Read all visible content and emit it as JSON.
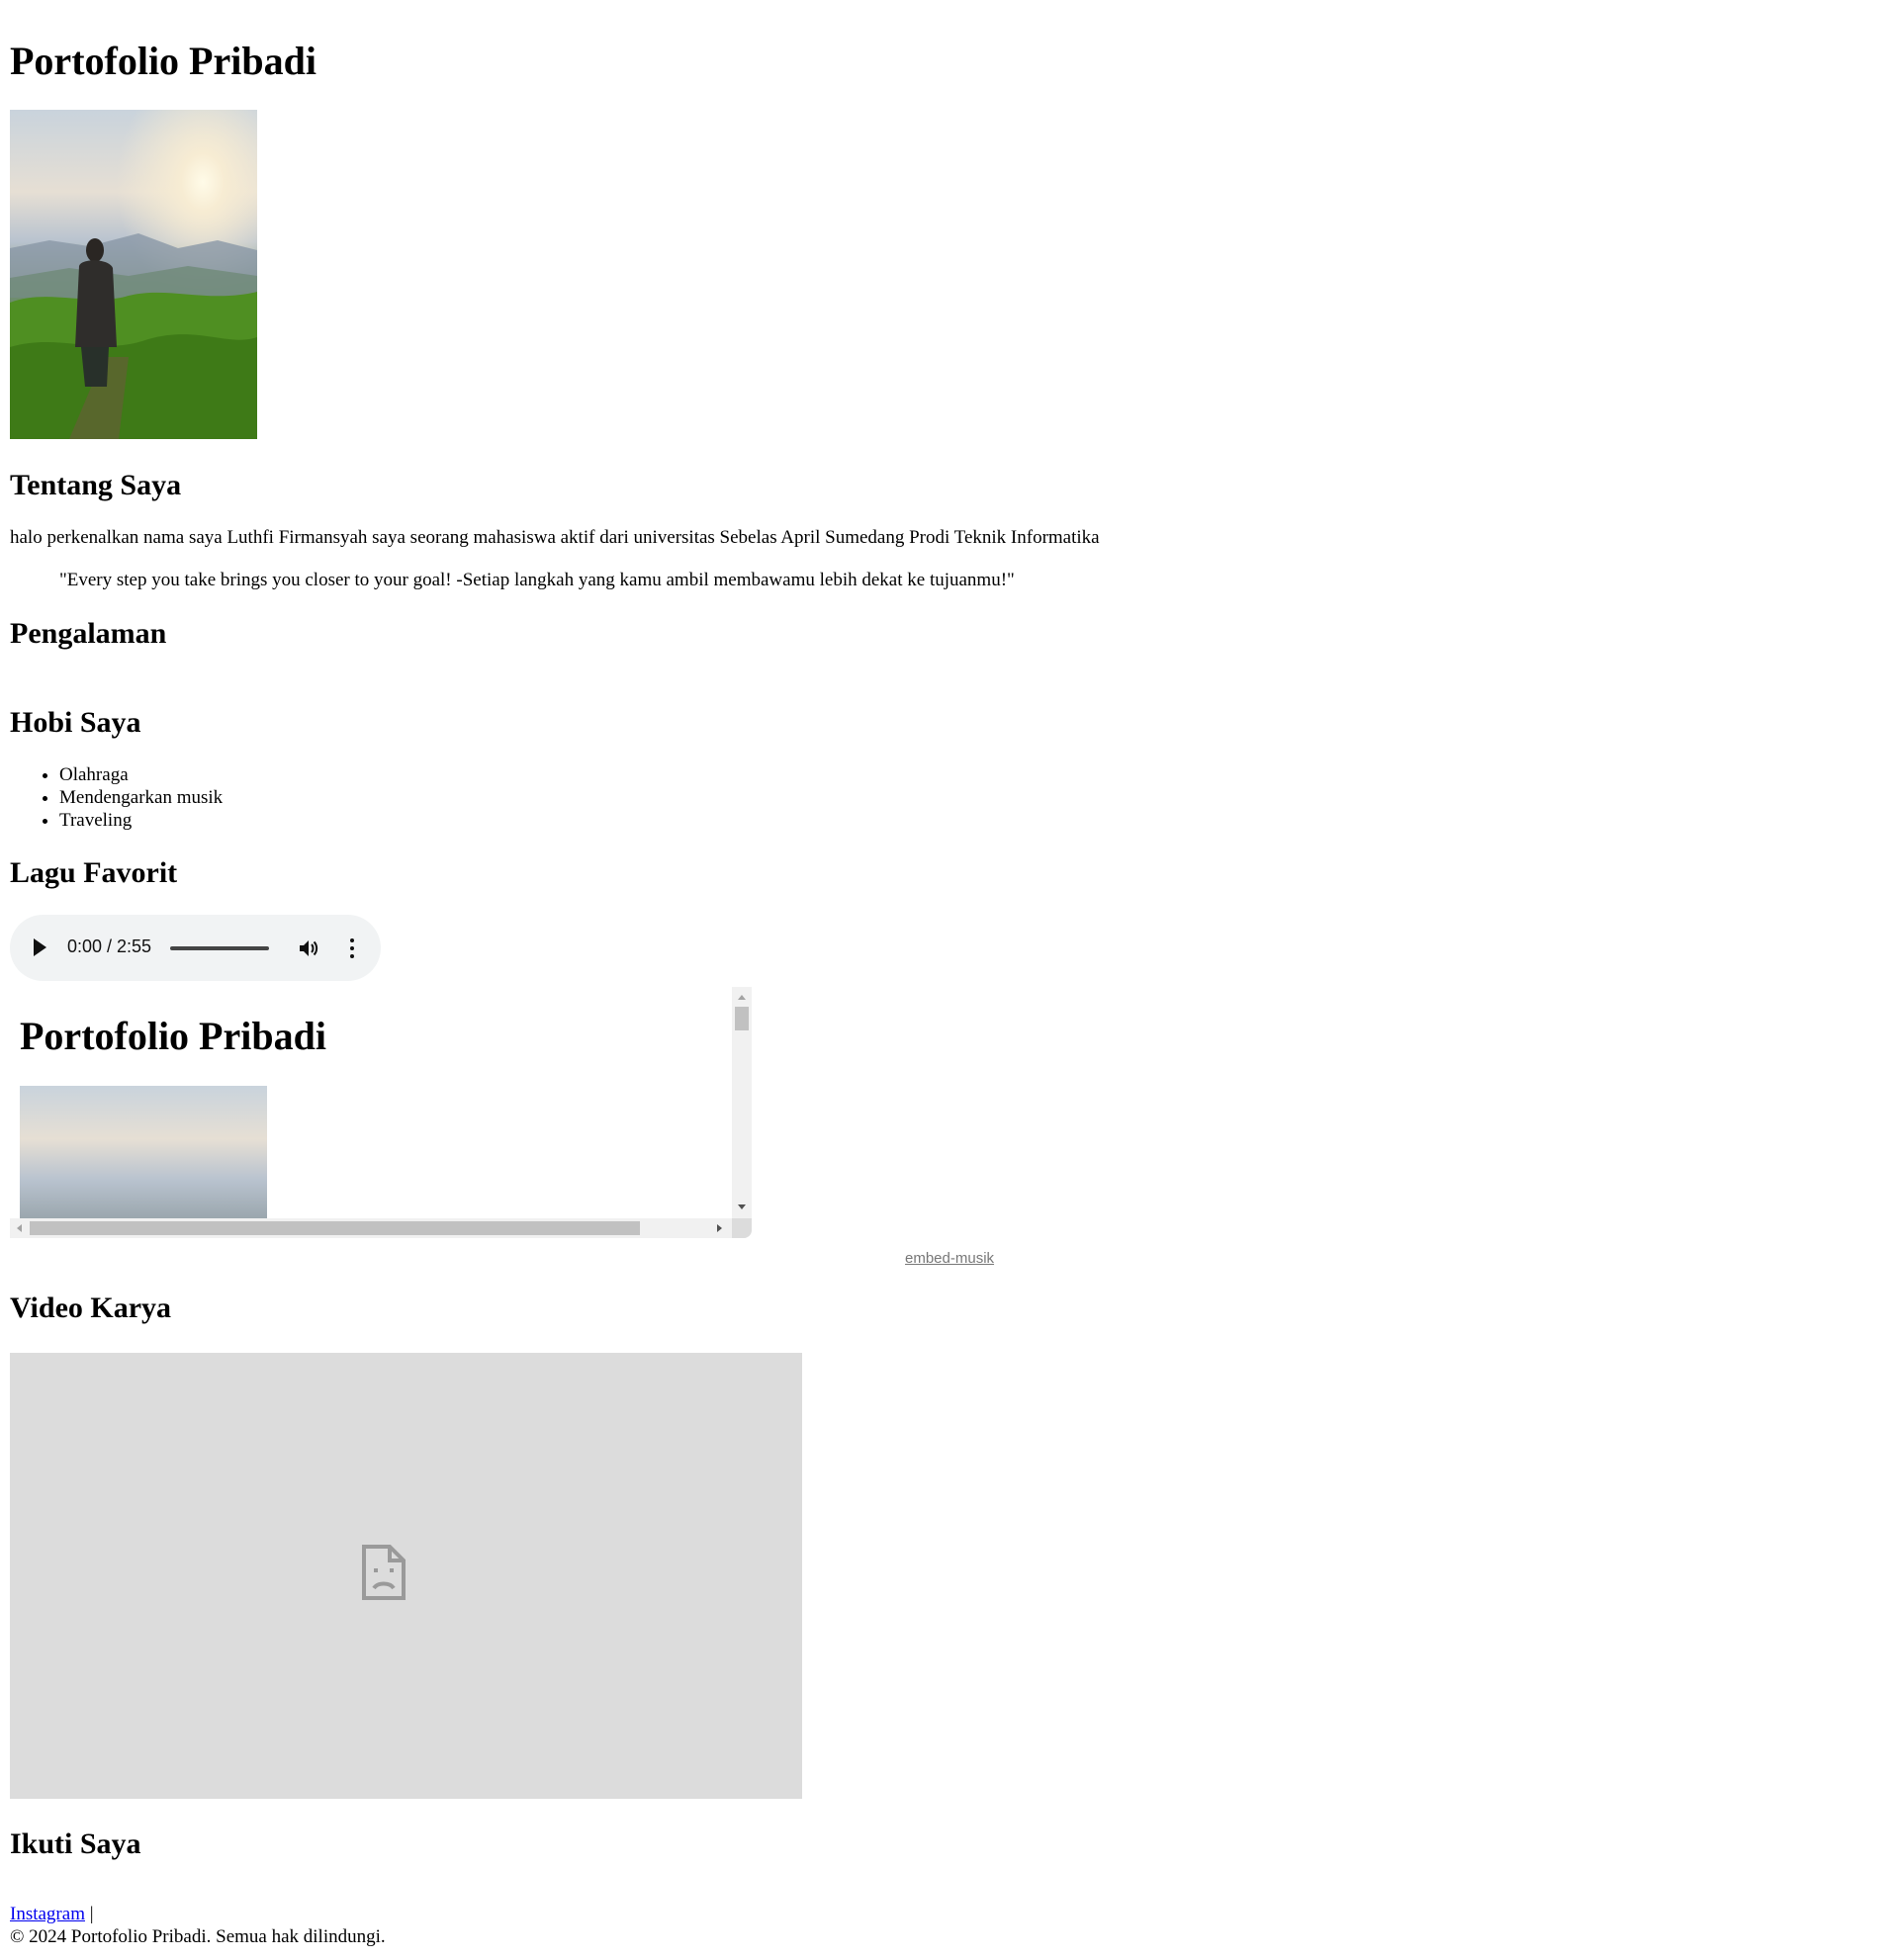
{
  "header": {
    "title": "Portofolio Pribadi"
  },
  "about": {
    "heading": "Tentang Saya",
    "text": "halo perkenalkan nama saya Luthfi Firmansyah saya seorang mahasiswa aktif dari universitas Sebelas April Sumedang Prodi Teknik Informatika",
    "quote": "\"Every step you take brings you closer to your goal! -Setiap langkah yang kamu ambil membawamu lebih dekat ke tujuanmu!\""
  },
  "experience": {
    "heading": "Pengalaman"
  },
  "hobbies": {
    "heading": "Hobi Saya",
    "items": [
      "Olahraga",
      "Mendengarkan musik",
      "Traveling"
    ]
  },
  "music": {
    "heading": "Lagu Favorit",
    "player": {
      "time": "0:00 / 2:55"
    },
    "embed": {
      "title": "Portofolio Pribadi",
      "link_label": "embed-musik"
    }
  },
  "video": {
    "heading": "Video Karya"
  },
  "social": {
    "heading": "Ikuti Saya",
    "instagram_label": "Instagram",
    "separator": "|"
  },
  "footer": {
    "copyright": "© 2024 Portofolio Pribadi. Semua hak dilindungi."
  }
}
